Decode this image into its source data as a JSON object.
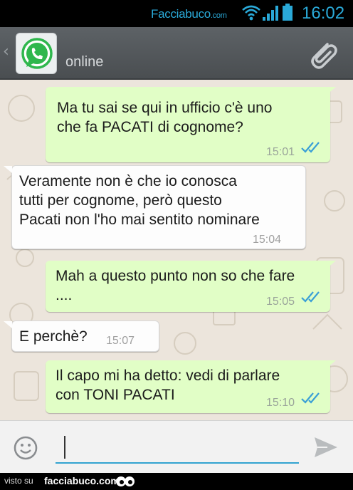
{
  "status_bar": {
    "brand": "Facciabuco",
    "brand_suffix": ".com",
    "time": "16:02",
    "accent_color": "#2aa9d8"
  },
  "header": {
    "back_icon": "chevron-left-icon",
    "avatar_icon": "whatsapp-logo",
    "status": "online",
    "attach_icon": "paperclip-icon"
  },
  "messages": [
    {
      "direction": "out",
      "text": "Ma tu sai se qui in ufficio c'è uno\nche fa PACATI di cognome?",
      "time": "15:01",
      "read": true
    },
    {
      "direction": "in",
      "text": "Veramente non è che io conosca\ntutti per cognome, però questo\nPacati non l'ho mai sentito nominare",
      "time": "15:04"
    },
    {
      "direction": "out",
      "text": "Mah a questo punto non so che fare\n....",
      "time": "15:05",
      "read": true
    },
    {
      "direction": "in",
      "text": "E perchè?",
      "time": "15:07"
    },
    {
      "direction": "out",
      "text": "Il capo mi ha detto: vedi di parlare\ncon TONI PACATI",
      "time": "15:10",
      "read": true
    }
  ],
  "input_bar": {
    "emoji_icon": "smiley-icon",
    "value": "",
    "send_icon": "send-icon"
  },
  "footer": {
    "visto": "visto su",
    "site": "facciabuco.com"
  },
  "colors": {
    "outgoing_bubble": "#e1fec6",
    "incoming_bubble": "#fdfdfd",
    "read_ticks": "#3a9fd6",
    "chat_background": "#ece5dc"
  }
}
